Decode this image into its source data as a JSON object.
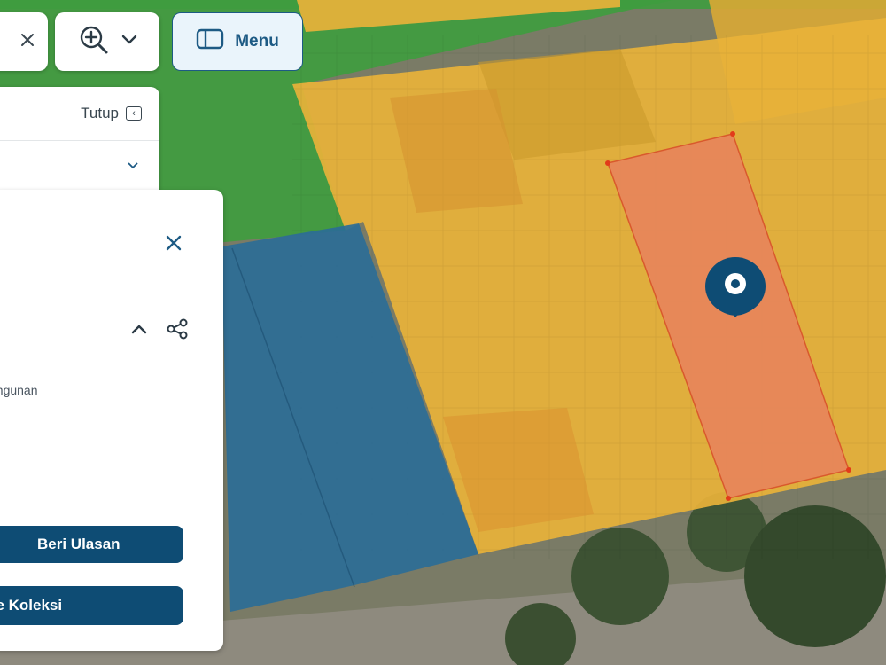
{
  "toolbar": {
    "menu_label": "Menu",
    "icons": [
      "close-icon",
      "zoom-in-icon",
      "chevron-down-icon",
      "sidebar-icon"
    ]
  },
  "side_panel": {
    "close_label": "Tutup"
  },
  "info_card": {
    "partial_text": "angunan",
    "review_button": "Beri Ulasan",
    "collection_button": "ke Koleksi"
  },
  "map": {
    "colors": {
      "green": "#3f9c3f",
      "yellow": "#e8b23a",
      "blue": "#2b6c96",
      "orange": "#e8875a",
      "marker": "#0e4c74"
    }
  }
}
